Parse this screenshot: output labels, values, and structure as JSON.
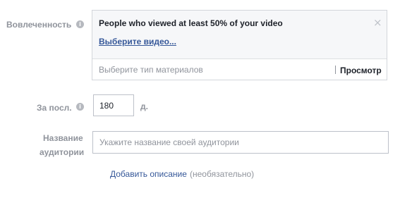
{
  "engagement": {
    "label": "Вовлеченность",
    "info_icon": "info-icon",
    "card_title": "People who viewed at least 50% of your video",
    "close_icon": "close-icon",
    "close_glyph": "×",
    "choose_video_link": "Выберите видео...",
    "type_placeholder": "Выберите тип материалов",
    "type_value": "",
    "browse_button": "Просмотр"
  },
  "period": {
    "label": "За посл.",
    "info_icon": "info-icon",
    "days_value": "180",
    "unit": "д."
  },
  "audience_name": {
    "label_line1": "Название",
    "label_line2": "аудитории",
    "placeholder": "Укажите название своей аудитории",
    "value": ""
  },
  "description": {
    "add_link": "Добавить описание",
    "optional_note": "(необязательно)"
  },
  "colors": {
    "link": "#365899",
    "muted_label": "#90949c",
    "card_background": "#f6f7f9",
    "border": "#bdc1c9"
  }
}
